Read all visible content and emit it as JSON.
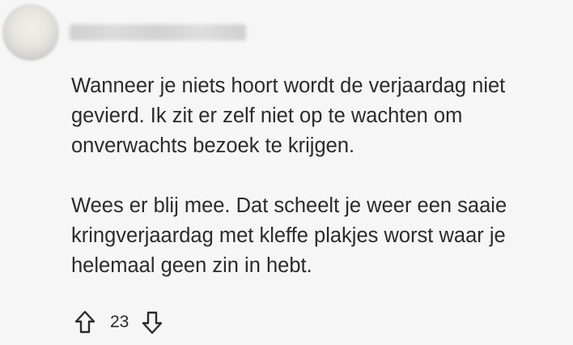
{
  "comment": {
    "author": "Frau_Bigmeh_2007",
    "paragraphs": [
      {
        "lines": [
          "Wanneer je niets hoort wordt de verjaardag niet",
          "gevierd. Ik zit er zelf niet op te wachten om",
          "onverwachts bezoek te krijgen."
        ]
      },
      {
        "lines": [
          "Wees er blij mee. Dat scheelt je weer een saaie",
          "kringverjaardag met kleffe plakjes worst waar je",
          "helemaal geen zin in hebt."
        ]
      }
    ],
    "votes": {
      "score": "23",
      "upvote_icon": "arrow-up-outline-icon",
      "downvote_icon": "arrow-down-outline-icon"
    }
  },
  "colors": {
    "background": "#f6f6f6",
    "text": "#2b2b2b"
  }
}
